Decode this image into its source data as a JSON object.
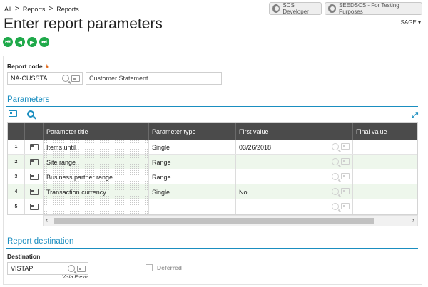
{
  "breadcrumb": {
    "items": [
      "All",
      "Reports",
      "Reports"
    ],
    "sep": ">"
  },
  "header": {
    "developer_pill": "SCS Developer",
    "folder_pill": "SEEDSCS - For Testing Purposes",
    "sage_menu": "SAGE ▾",
    "title": "Enter report parameters"
  },
  "nav": {
    "first": "⏮",
    "prev": "◀",
    "next": "▶",
    "last": "⏭"
  },
  "report_code": {
    "label": "Report code",
    "required_marker": "★",
    "value": "NA-CUSSTA",
    "description": "Customer Statement"
  },
  "parameters": {
    "section_title": "Parameters",
    "expand_icon": "⤢",
    "columns": [
      "Parameter title",
      "Parameter type",
      "First value",
      "Final value"
    ],
    "rows": [
      {
        "num": "1",
        "title": "Items until",
        "type": "Single",
        "first": "03/26/2018",
        "final": ""
      },
      {
        "num": "2",
        "title": "Site range",
        "type": "Range",
        "first": "",
        "final": ""
      },
      {
        "num": "3",
        "title": "Business partner range",
        "type": "Range",
        "first": "",
        "final": ""
      },
      {
        "num": "4",
        "title": "Transaction currency",
        "type": "Single",
        "first": "No",
        "final": ""
      },
      {
        "num": "5",
        "title": "",
        "type": "",
        "first": "",
        "final": ""
      }
    ],
    "scroll_left": "‹",
    "scroll_right": "›"
  },
  "destination": {
    "section_title": "Report destination",
    "label": "Destination",
    "value": "VISTAP",
    "sublabel": "Vista Previa",
    "deferred_label": "Deferred"
  }
}
